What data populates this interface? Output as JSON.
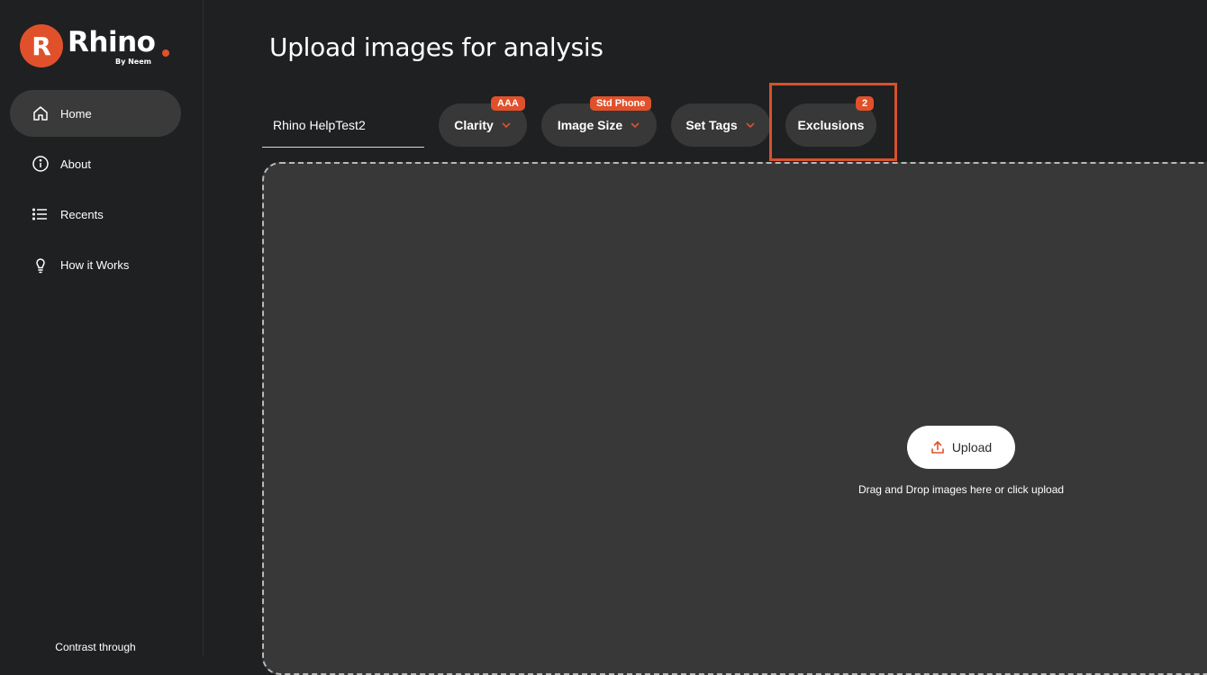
{
  "brand": {
    "name": "Rhino",
    "subtitle": "By Neem",
    "accent_color": "#e0512b"
  },
  "sidebar": {
    "items": [
      {
        "label": "Home",
        "icon": "home-icon",
        "active": true
      },
      {
        "label": "About",
        "icon": "info-icon",
        "active": false
      },
      {
        "label": "Recents",
        "icon": "list-icon",
        "active": false
      },
      {
        "label": "How it Works",
        "icon": "lightbulb-icon",
        "active": false
      }
    ],
    "footer_text": "Contrast through"
  },
  "main": {
    "title": "Upload images for analysis",
    "project_name": "Rhino HelpTest2",
    "filters": [
      {
        "label": "Clarity",
        "badge": "AAA",
        "has_dropdown": true
      },
      {
        "label": "Image Size",
        "badge": "Std Phone",
        "has_dropdown": true
      },
      {
        "label": "Set Tags",
        "badge": "",
        "has_dropdown": true
      },
      {
        "label": "Exclusions",
        "badge": "2",
        "has_dropdown": false
      }
    ],
    "upload": {
      "button_label": "Upload",
      "hint": "Drag and Drop images here or click upload"
    }
  }
}
